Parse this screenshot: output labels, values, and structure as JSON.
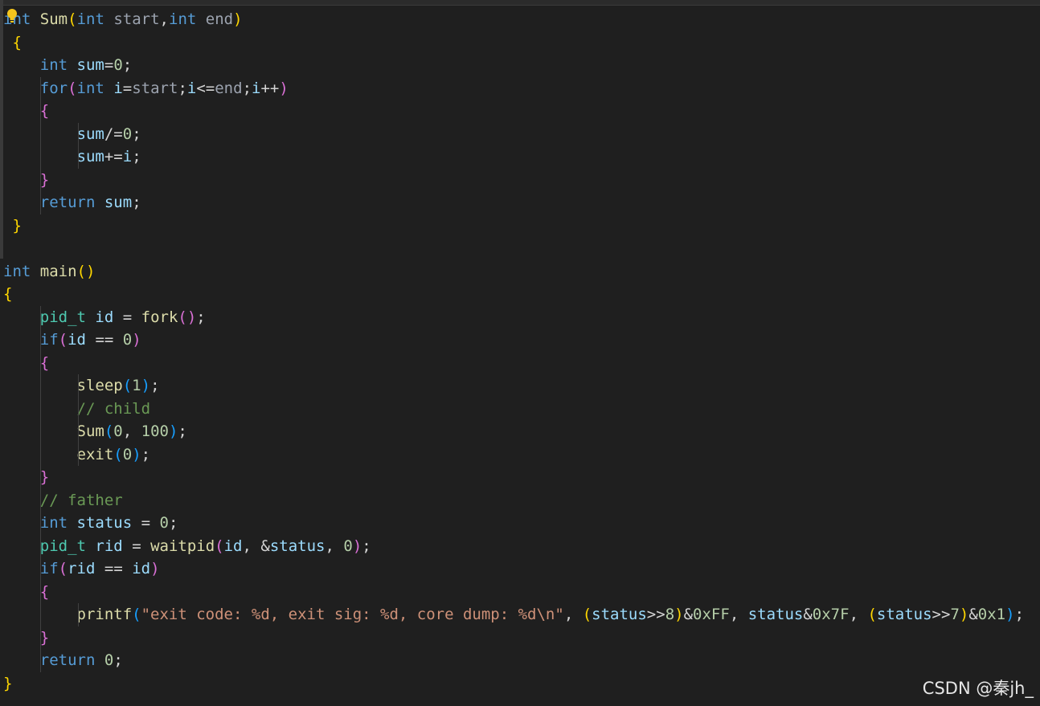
{
  "editor": {
    "lines": [
      [
        {
          "t": "int",
          "c": "kw"
        },
        {
          "t": " "
        },
        {
          "t": "Sum",
          "c": "fn"
        },
        {
          "t": "(",
          "c": "b1"
        },
        {
          "t": "int",
          "c": "kw"
        },
        {
          "t": " "
        },
        {
          "t": "start",
          "c": "par"
        },
        {
          "t": ","
        },
        {
          "t": "int",
          "c": "kw"
        },
        {
          "t": " "
        },
        {
          "t": "end",
          "c": "par"
        },
        {
          "t": ")",
          "c": "b1"
        }
      ],
      [
        {
          "t": " "
        },
        {
          "t": "{",
          "c": "b1"
        }
      ],
      [
        {
          "t": "    "
        },
        {
          "t": "int",
          "c": "kw"
        },
        {
          "t": " "
        },
        {
          "t": "sum",
          "c": "var"
        },
        {
          "t": "="
        },
        {
          "t": "0",
          "c": "num"
        },
        {
          "t": ";"
        }
      ],
      [
        {
          "t": "    "
        },
        {
          "t": "for",
          "c": "kw"
        },
        {
          "t": "(",
          "c": "b2"
        },
        {
          "t": "int",
          "c": "kw"
        },
        {
          "t": " "
        },
        {
          "t": "i",
          "c": "var"
        },
        {
          "t": "="
        },
        {
          "t": "start",
          "c": "par"
        },
        {
          "t": ";"
        },
        {
          "t": "i",
          "c": "var"
        },
        {
          "t": "<="
        },
        {
          "t": "end",
          "c": "par"
        },
        {
          "t": ";"
        },
        {
          "t": "i",
          "c": "var"
        },
        {
          "t": "++"
        },
        {
          "t": ")",
          "c": "b2"
        }
      ],
      [
        {
          "t": "    "
        },
        {
          "t": "{",
          "c": "b2"
        }
      ],
      [
        {
          "t": "        "
        },
        {
          "t": "sum",
          "c": "var"
        },
        {
          "t": "/="
        },
        {
          "t": "0",
          "c": "num"
        },
        {
          "t": ";"
        }
      ],
      [
        {
          "t": "        "
        },
        {
          "t": "sum",
          "c": "var"
        },
        {
          "t": "+="
        },
        {
          "t": "i",
          "c": "var"
        },
        {
          "t": ";"
        }
      ],
      [
        {
          "t": "    "
        },
        {
          "t": "}",
          "c": "b2"
        }
      ],
      [
        {
          "t": "    "
        },
        {
          "t": "return",
          "c": "kw"
        },
        {
          "t": " "
        },
        {
          "t": "sum",
          "c": "var"
        },
        {
          "t": ";"
        }
      ],
      [
        {
          "t": " "
        },
        {
          "t": "}",
          "c": "b1"
        }
      ],
      [],
      [
        {
          "t": "int",
          "c": "kw"
        },
        {
          "t": " "
        },
        {
          "t": "main",
          "c": "fn"
        },
        {
          "t": "()",
          "c": "b1"
        }
      ],
      [
        {
          "t": "{",
          "c": "b1"
        }
      ],
      [
        {
          "t": "    "
        },
        {
          "t": "pid_t",
          "c": "ty"
        },
        {
          "t": " "
        },
        {
          "t": "id",
          "c": "var"
        },
        {
          "t": " = "
        },
        {
          "t": "fork",
          "c": "fn"
        },
        {
          "t": "()",
          "c": "b2"
        },
        {
          "t": ";"
        }
      ],
      [
        {
          "t": "    "
        },
        {
          "t": "if",
          "c": "kw"
        },
        {
          "t": "(",
          "c": "b2"
        },
        {
          "t": "id",
          "c": "var"
        },
        {
          "t": " == "
        },
        {
          "t": "0",
          "c": "num"
        },
        {
          "t": ")",
          "c": "b2"
        }
      ],
      [
        {
          "t": "    "
        },
        {
          "t": "{",
          "c": "b2"
        }
      ],
      [
        {
          "t": "        "
        },
        {
          "t": "sleep",
          "c": "fn"
        },
        {
          "t": "(",
          "c": "b3"
        },
        {
          "t": "1",
          "c": "num"
        },
        {
          "t": ")",
          "c": "b3"
        },
        {
          "t": ";"
        }
      ],
      [
        {
          "t": "        "
        },
        {
          "t": "// child",
          "c": "cm"
        }
      ],
      [
        {
          "t": "        "
        },
        {
          "t": "Sum",
          "c": "fn"
        },
        {
          "t": "(",
          "c": "b3"
        },
        {
          "t": "0",
          "c": "num"
        },
        {
          "t": ", "
        },
        {
          "t": "100",
          "c": "num"
        },
        {
          "t": ")",
          "c": "b3"
        },
        {
          "t": ";"
        }
      ],
      [
        {
          "t": "        "
        },
        {
          "t": "exit",
          "c": "fn"
        },
        {
          "t": "(",
          "c": "b3"
        },
        {
          "t": "0",
          "c": "num"
        },
        {
          "t": ")",
          "c": "b3"
        },
        {
          "t": ";"
        }
      ],
      [
        {
          "t": "    "
        },
        {
          "t": "}",
          "c": "b2"
        }
      ],
      [
        {
          "t": "    "
        },
        {
          "t": "// father",
          "c": "cm"
        }
      ],
      [
        {
          "t": "    "
        },
        {
          "t": "int",
          "c": "kw"
        },
        {
          "t": " "
        },
        {
          "t": "status",
          "c": "var"
        },
        {
          "t": " = "
        },
        {
          "t": "0",
          "c": "num"
        },
        {
          "t": ";"
        }
      ],
      [
        {
          "t": "    "
        },
        {
          "t": "pid_t",
          "c": "ty"
        },
        {
          "t": " "
        },
        {
          "t": "rid",
          "c": "var"
        },
        {
          "t": " = "
        },
        {
          "t": "waitpid",
          "c": "fn"
        },
        {
          "t": "(",
          "c": "b2"
        },
        {
          "t": "id",
          "c": "var"
        },
        {
          "t": ", &"
        },
        {
          "t": "status",
          "c": "var"
        },
        {
          "t": ", "
        },
        {
          "t": "0",
          "c": "num"
        },
        {
          "t": ")",
          "c": "b2"
        },
        {
          "t": ";"
        }
      ],
      [
        {
          "t": "    "
        },
        {
          "t": "if",
          "c": "kw"
        },
        {
          "t": "(",
          "c": "b2"
        },
        {
          "t": "rid",
          "c": "var"
        },
        {
          "t": " == "
        },
        {
          "t": "id",
          "c": "var"
        },
        {
          "t": ")",
          "c": "b2"
        }
      ],
      [
        {
          "t": "    "
        },
        {
          "t": "{",
          "c": "b2"
        }
      ],
      [
        {
          "t": "        "
        },
        {
          "t": "printf",
          "c": "fn"
        },
        {
          "t": "(",
          "c": "b3"
        },
        {
          "t": "\"exit code: %d, exit sig: %d, core dump: %d\\n\"",
          "c": "str"
        },
        {
          "t": ", "
        },
        {
          "t": "(",
          "c": "b1"
        },
        {
          "t": "status",
          "c": "var"
        },
        {
          "t": ">>"
        },
        {
          "t": "8",
          "c": "num"
        },
        {
          "t": ")",
          "c": "b1"
        },
        {
          "t": "&"
        },
        {
          "t": "0xFF",
          "c": "num"
        },
        {
          "t": ", "
        },
        {
          "t": "status",
          "c": "var"
        },
        {
          "t": "&"
        },
        {
          "t": "0x7F",
          "c": "num"
        },
        {
          "t": ", "
        },
        {
          "t": "(",
          "c": "b1"
        },
        {
          "t": "status",
          "c": "var"
        },
        {
          "t": ">>"
        },
        {
          "t": "7",
          "c": "num"
        },
        {
          "t": ")",
          "c": "b1"
        },
        {
          "t": "&"
        },
        {
          "t": "0x1",
          "c": "num"
        },
        {
          "t": ")",
          "c": "b3"
        },
        {
          "t": ";"
        }
      ],
      [
        {
          "t": "    "
        },
        {
          "t": "}",
          "c": "b2"
        }
      ],
      [
        {
          "t": "    "
        },
        {
          "t": "return",
          "c": "kw"
        },
        {
          "t": " "
        },
        {
          "t": "0",
          "c": "num"
        },
        {
          "t": ";"
        }
      ],
      [
        {
          "t": "}",
          "c": "b1"
        }
      ]
    ]
  },
  "watermark": "CSDN @秦jh_",
  "icons": {
    "lightbulb": "lightbulb-icon"
  }
}
